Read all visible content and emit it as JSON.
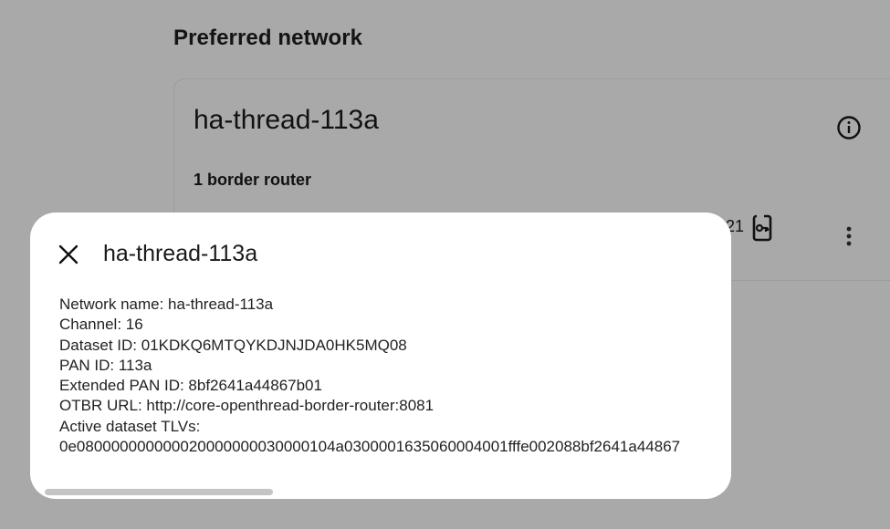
{
  "page": {
    "section_title": "Preferred network"
  },
  "card": {
    "network_name": "ha-thread-113a",
    "border_router_count": "1 border router",
    "router_id_suffix": "21",
    "info_icon": "info-circle-icon",
    "router_icon": "router-key-icon",
    "more_icon": "more-vertical-icon"
  },
  "dialog": {
    "title": "ha-thread-113a",
    "close_icon": "close-icon",
    "lines": [
      "Network name: ha-thread-113a",
      "Channel: 16",
      "Dataset ID: 01KDKQ6MTQYKDJNJDA0HK5MQ08",
      "PAN ID: 113a",
      "Extended PAN ID: 8bf2641a44867b01",
      "OTBR URL: http://core-openthread-border-router:8081",
      "Active dataset TLVs:",
      "0e080000000000020000000030000104a0300001635060004001fffe002088bf2641a44867"
    ]
  },
  "scrollbar": {
    "position_fraction": 0
  },
  "colors": {
    "backdrop": "#a9a9a9",
    "dialog_bg": "#ffffff",
    "text": "#141414"
  }
}
